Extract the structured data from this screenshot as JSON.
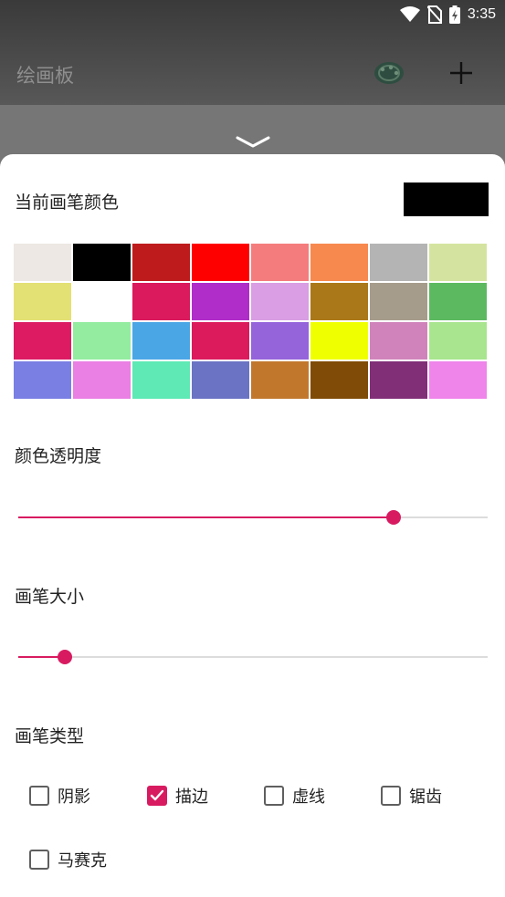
{
  "status_bar": {
    "time": "3:35",
    "icons": [
      "wifi-icon",
      "no-sim-icon",
      "battery-charging-icon"
    ]
  },
  "toolbar": {
    "title": "绘画板",
    "icons": [
      "palette-icon",
      "plus-icon"
    ]
  },
  "sheet": {
    "handle_icon": "chevron-down-icon",
    "current_color": {
      "label": "当前画笔颜色",
      "value": "#000000"
    },
    "palette": [
      "#ede8e3",
      "#000000",
      "#be1c1c",
      "#fe0000",
      "#f57c7c",
      "#f7894f",
      "#b4b4b4",
      "#d4e4a0",
      "#e3e074",
      "#ffffff",
      "#da1a5c",
      "#b02dc9",
      "#d99ee3",
      "#ab7819",
      "#a69c8b",
      "#5cb960",
      "#dc1b63",
      "#93eca0",
      "#4ba6e6",
      "#dc1b5d",
      "#9563da",
      "#f0ff00",
      "#d083ba",
      "#a8e58e",
      "#7a7fe4",
      "#ea7fe4",
      "#5ee9b5",
      "#6b73c4",
      "#c1782d",
      "#804b06",
      "#812f77",
      "#ef84ea"
    ],
    "opacity": {
      "label": "颜色透明度",
      "value": 0.8
    },
    "brush_size": {
      "label": "画笔大小",
      "value": 0.1
    },
    "brush_type": {
      "label": "画笔类型",
      "options": [
        {
          "label": "阴影",
          "checked": false
        },
        {
          "label": "描边",
          "checked": true
        },
        {
          "label": "虚线",
          "checked": false
        },
        {
          "label": "锯齿",
          "checked": false
        },
        {
          "label": "马赛克",
          "checked": false
        }
      ]
    },
    "accent_color": "#d81b60"
  }
}
